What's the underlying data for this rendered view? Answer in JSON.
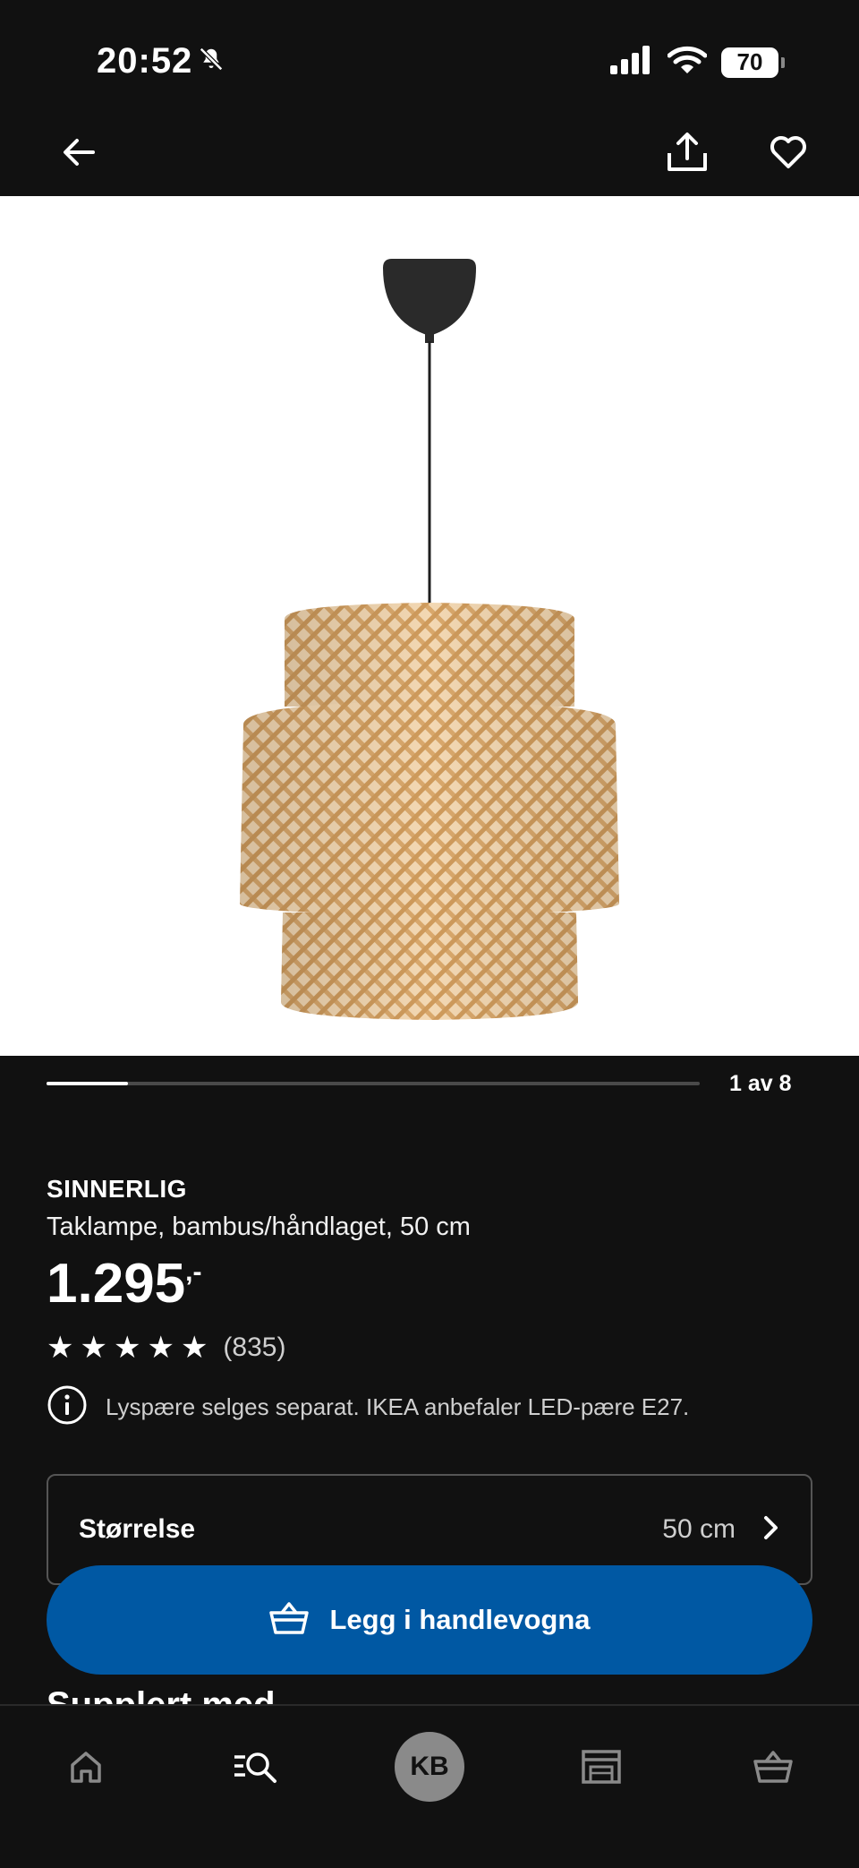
{
  "status_bar": {
    "time": "20:52",
    "battery": "70"
  },
  "product": {
    "name": "SINNERLIG",
    "description": "Taklampe, bambus/håndlaget, 50 cm",
    "price": "1.295",
    "price_suffix": ",-",
    "rating": {
      "stars": 5,
      "count": "(835)"
    },
    "info_note": "Lyspære selges separat. IKEA anbefaler LED-pære E27."
  },
  "gallery": {
    "counter": "1 av 8",
    "progress_fraction": 0.125
  },
  "size_selector": {
    "label": "Størrelse",
    "value": "50 cm"
  },
  "cart_button": {
    "label": "Legg i handlevogna"
  },
  "next_section": {
    "heading": "Supplert med"
  },
  "bottom_nav": {
    "avatar_initials": "KB",
    "tabs": [
      "home-icon",
      "search-icon",
      "profile-avatar",
      "store-icon",
      "basket-icon"
    ]
  },
  "colors": {
    "background": "#111111",
    "accent_blue": "#0058a3",
    "image_background": "#ffffff",
    "bamboo": "#e0b888"
  }
}
